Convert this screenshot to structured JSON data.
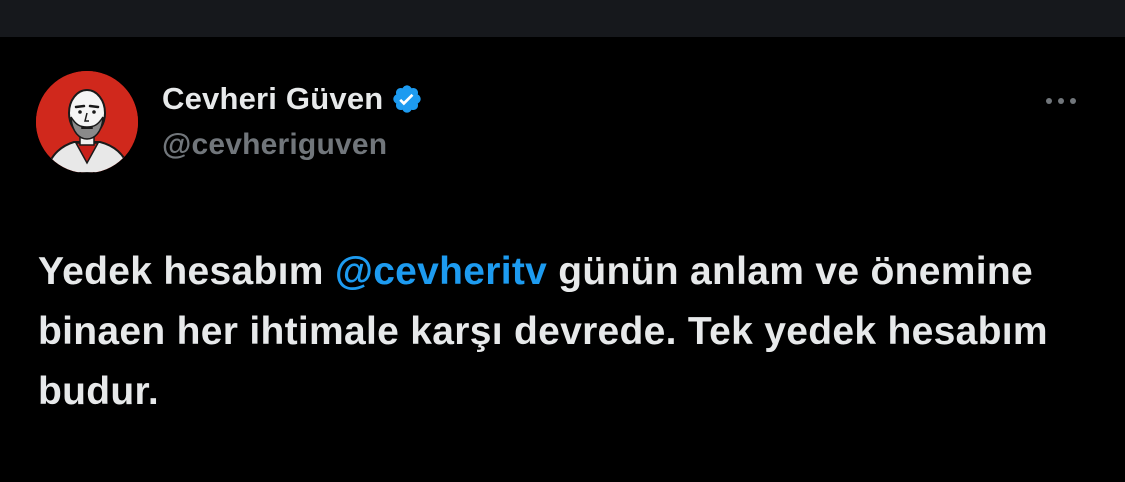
{
  "author": {
    "display_name": "Cevheri Güven",
    "handle": "@cevheriguven",
    "verified": true,
    "avatar_icon": "avatar-portrait-icon"
  },
  "tweet": {
    "text_before": "Yedek hesabım ",
    "mention": "@cevheritv",
    "text_after": " günün anlam ve önemine binaen her ihtimale karşı devrede. Tek yedek hesabım budur."
  },
  "icons": {
    "verified": "verified-badge-icon",
    "more": "more-options-icon"
  },
  "colors": {
    "background": "#000000",
    "text_primary": "#e7e9ea",
    "text_secondary": "#71767b",
    "accent": "#1d9bf0",
    "avatar_background": "#d0281c"
  }
}
